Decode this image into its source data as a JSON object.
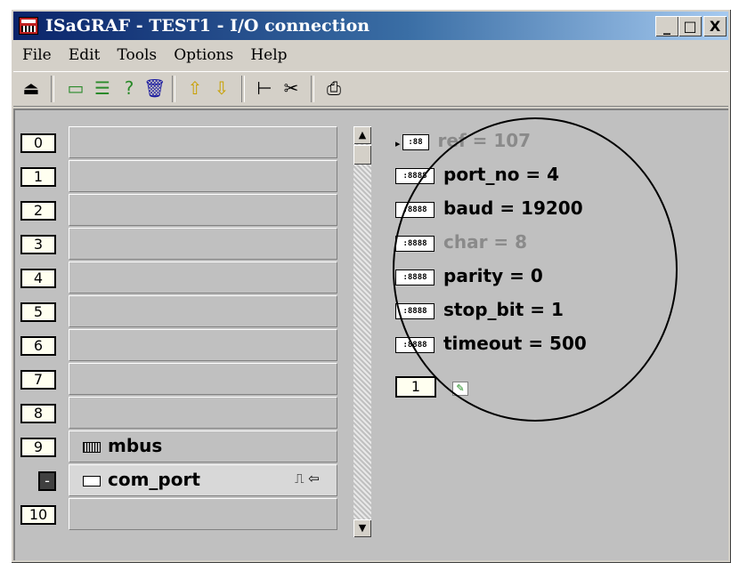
{
  "window": {
    "title": "ISaGRAF - TEST1 - I/O connection",
    "controls": {
      "minimize": "_",
      "maximize": "□",
      "close": "X"
    }
  },
  "menu": [
    "File",
    "Edit",
    "Tools",
    "Options",
    "Help"
  ],
  "toolbar": {
    "icons": [
      "open-board-icon",
      "card-icon",
      "multi-card-icon",
      "help-card-icon",
      "delete-icon",
      "move-up-icon",
      "move-down-icon",
      "connect-icon",
      "tools-icon",
      "print-icon"
    ]
  },
  "slots": [
    {
      "number": "0",
      "label": ""
    },
    {
      "number": "1",
      "label": ""
    },
    {
      "number": "2",
      "label": ""
    },
    {
      "number": "3",
      "label": ""
    },
    {
      "number": "4",
      "label": ""
    },
    {
      "number": "5",
      "label": ""
    },
    {
      "number": "6",
      "label": ""
    },
    {
      "number": "7",
      "label": ""
    },
    {
      "number": "8",
      "label": ""
    },
    {
      "number": "9",
      "label": "mbus"
    },
    {
      "number": "-",
      "label": "com_port",
      "suffix": "⎍ ⇦"
    },
    {
      "number": "10",
      "label": ""
    }
  ],
  "params": [
    {
      "text": "ref = 107",
      "icon": ":88",
      "dimmed": true,
      "marker": "▸"
    },
    {
      "text": "port_no = 4",
      "icon": ":8888",
      "dimmed": false
    },
    {
      "text": "baud = 19200",
      "icon": ":8888",
      "dimmed": false
    },
    {
      "text": "char = 8",
      "icon": ":8888",
      "dimmed": true
    },
    {
      "text": "parity = 0",
      "icon": ":8888",
      "dimmed": false
    },
    {
      "text": "stop_bit = 1",
      "icon": ":8888",
      "dimmed": false
    },
    {
      "text": "timeout = 500",
      "icon": ":8888",
      "dimmed": false
    }
  ],
  "channel": {
    "number": "1"
  }
}
